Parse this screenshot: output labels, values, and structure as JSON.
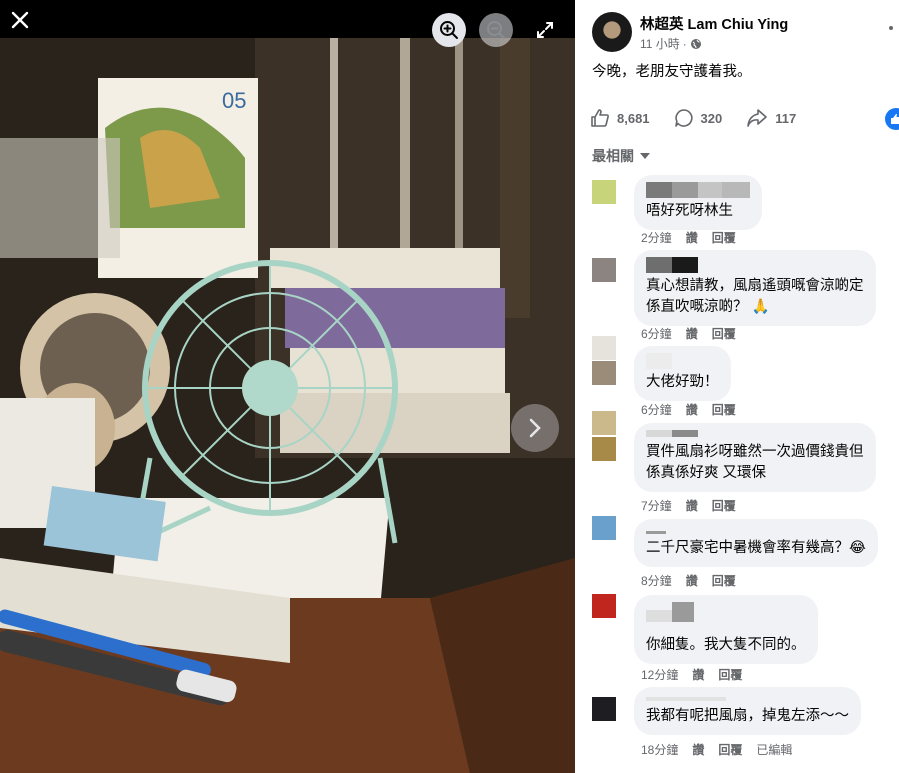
{
  "viewer": {
    "icons": {
      "close": "close-icon",
      "zoom_in": "zoom-in-icon",
      "zoom_out": "zoom-out-icon",
      "fullscreen": "fullscreen-icon",
      "next": "chevron-right-icon"
    }
  },
  "post": {
    "author": "林超英 Lam Chiu Ying",
    "time": "11 小時",
    "separator": "·",
    "privacy_icon": "globe-icon",
    "text": "今晚，老朋友守護着我。",
    "likes": "8,681",
    "comments_count": "320",
    "shares": "117",
    "sort_label": "最相關"
  },
  "comments": [
    {
      "text": "唔好死呀林生",
      "time": "2分鐘",
      "like": "讚",
      "reply": "回覆",
      "avatar_color": "#c8d47a"
    },
    {
      "text": "真心想請教，風扇遙頭嘅會涼啲定\n係直吹嘅涼啲？ 🙏",
      "time": "6分鐘",
      "like": "讚",
      "reply": "回覆",
      "avatar_color": "#8c8480"
    },
    {
      "text": "大佬好勁！",
      "time": "6分鐘",
      "like": "讚",
      "reply": "回覆",
      "avatar_color": "#9a8c78"
    },
    {
      "text": "買件風扇衫呀雖然一次過價錢貴但\n係真係好爽 又環保",
      "time": "7分鐘",
      "like": "讚",
      "reply": "回覆",
      "avatar_color": "#a88a48"
    },
    {
      "text": "二千尺豪宅中暑機會率有幾高？😂",
      "time": "8分鐘",
      "like": "讚",
      "reply": "回覆",
      "avatar_color": "#6aa0cc"
    },
    {
      "text": "你細隻。我大隻不同的。",
      "time": "12分鐘",
      "like": "讚",
      "reply": "回覆",
      "avatar_color": "#c0261e"
    },
    {
      "text": "我都有呢把風扇，掉鬼左添～～",
      "time": "18分鐘",
      "like": "讚",
      "reply": "回覆",
      "edited": "已編輯",
      "avatar_color": "#1e1e22"
    }
  ],
  "colors": {
    "accent": "#1877f2",
    "bubble": "#f0f2f5",
    "secondary_text": "#65676b"
  }
}
